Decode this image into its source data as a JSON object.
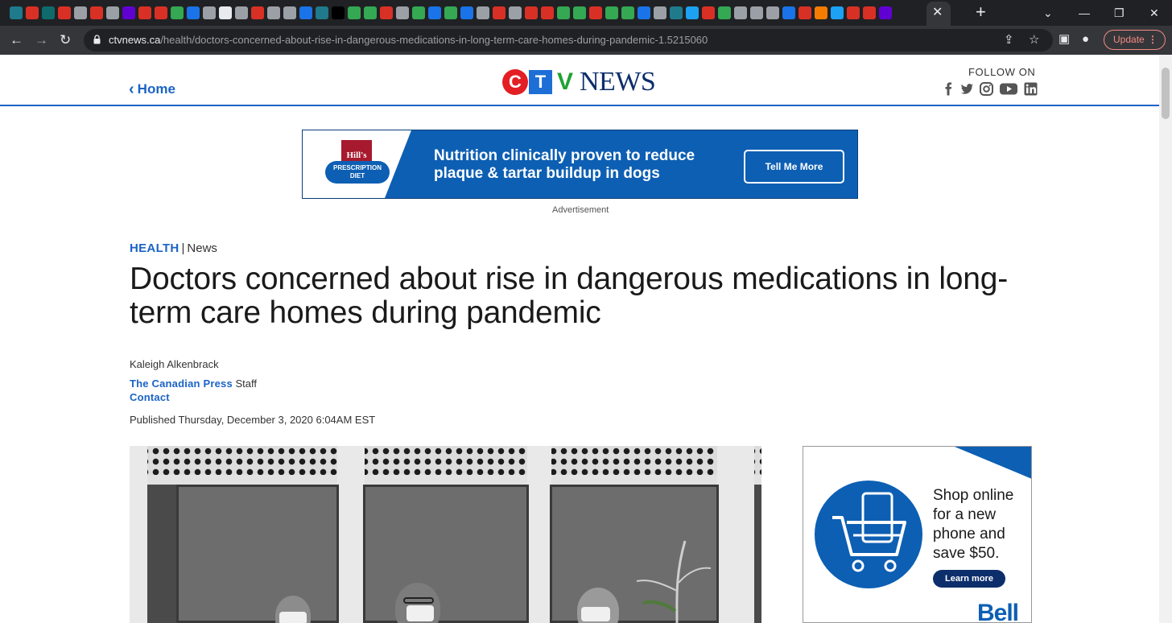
{
  "browser": {
    "url_domain": "ctvnews.ca",
    "url_path": "/health/doctors-concerned-about-rise-in-dangerous-medications-in-long-term-care-homes-during-pandemic-1.5215060",
    "update_label": "Update",
    "tab_close_glyph": "✕",
    "new_tab_glyph": "+",
    "tab_favicon_colors": [
      "#1f7a8c",
      "#d93025",
      "#0f6b6b",
      "#d93025",
      "#9aa0a6",
      "#d93025",
      "#9aa0a6",
      "#6001d2",
      "#d93025",
      "#d93025",
      "#34a853",
      "#1a73e8",
      "#9aa0a6",
      "#e8eaed",
      "#9aa0a6",
      "#d93025",
      "#9aa0a6",
      "#9aa0a6",
      "#1a73e8",
      "#1f7a8c",
      "#000000",
      "#34a853",
      "#34a853",
      "#d93025",
      "#9aa0a6",
      "#34a853",
      "#1a73e8",
      "#34a853",
      "#1a73e8",
      "#9aa0a6",
      "#d93025",
      "#9aa0a6",
      "#d93025",
      "#d93025",
      "#34a853",
      "#34a853",
      "#d93025",
      "#34a853",
      "#34a853",
      "#1a73e8",
      "#9aa0a6",
      "#1f7a8c",
      "#1da1f2",
      "#d93025",
      "#34a853",
      "#9aa0a6",
      "#9aa0a6",
      "#9aa0a6",
      "#1a73e8",
      "#d93025",
      "#f57c00",
      "#1da1f2",
      "#d93025",
      "#d93025",
      "#6001d2"
    ]
  },
  "header": {
    "home_label": "Home",
    "logo": {
      "c": "C",
      "t": "T",
      "v": "V",
      "news": "NEWS"
    },
    "follow_label": "FOLLOW ON",
    "social_icons": [
      "facebook-icon",
      "twitter-icon",
      "instagram-icon",
      "youtube-icon",
      "linkedin-icon"
    ],
    "accent_color": "#1b63c6"
  },
  "banner_ad": {
    "brand_top": "Hill's",
    "brand_bottom": "PRESCRIPTION DIET",
    "headline": "Nutrition clinically proven to reduce plaque & tartar buildup in dogs",
    "cta": "Tell Me More",
    "label": "Advertisement"
  },
  "article": {
    "category": "HEALTH",
    "separator": "|",
    "subcategory": "News",
    "headline": "Doctors concerned about rise in dangerous medications in long-term care homes during pandemic",
    "author": "Kaleigh Alkenbrack",
    "org_link": "The Canadian Press",
    "org_role": "Staff",
    "contact": "Contact",
    "published": "Published Thursday, December 3, 2020 6:04AM EST"
  },
  "side_ad": {
    "text": "Shop online for a new phone and save $50.",
    "cta": "Learn more",
    "brand": "Bell"
  }
}
